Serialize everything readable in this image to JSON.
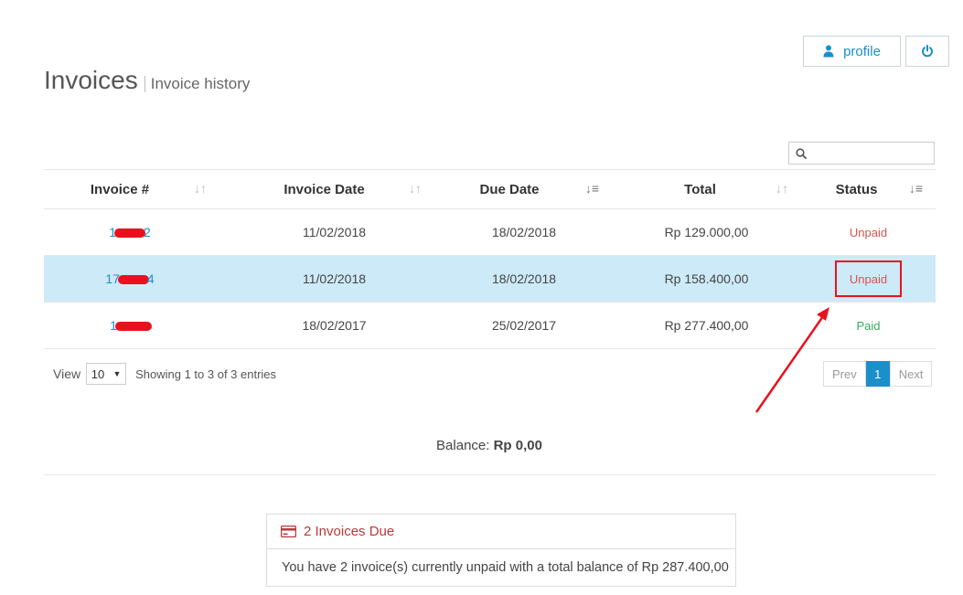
{
  "header": {
    "title": "Invoices",
    "subtitle": "Invoice history",
    "profile_label": "profile"
  },
  "table": {
    "columns": [
      "Invoice #",
      "Invoice Date",
      "Due Date",
      "Total",
      "Status"
    ],
    "rows": [
      {
        "invoice_prefix": "1",
        "invoice_suffix": "2",
        "invoice_date": "11/02/2018",
        "due_date": "18/02/2018",
        "total": "Rp 129.000,00",
        "status": "Unpaid"
      },
      {
        "invoice_prefix": "17",
        "invoice_suffix": "4",
        "invoice_date": "11/02/2018",
        "due_date": "18/02/2018",
        "total": "Rp 158.400,00",
        "status": "Unpaid"
      },
      {
        "invoice_prefix": "1",
        "invoice_suffix": "",
        "invoice_date": "18/02/2017",
        "due_date": "25/02/2017",
        "total": "Rp 277.400,00",
        "status": "Paid"
      }
    ]
  },
  "footer": {
    "view_label": "View",
    "page_size": "10",
    "showing": "Showing 1 to 3 of 3 entries",
    "prev": "Prev",
    "current_page": "1",
    "next": "Next"
  },
  "balance": {
    "label": "Balance:",
    "value": "Rp 0,00"
  },
  "due_panel": {
    "title": "2 Invoices Due",
    "message": "You have 2 invoice(s) currently unpaid with a total balance of Rp 287.400,00"
  },
  "colors": {
    "accent": "#1a8fc9",
    "selected_row": "#cdeaf8",
    "unpaid": "#d9534f",
    "paid": "#3aaa5d",
    "annotation": "#e8121e"
  }
}
